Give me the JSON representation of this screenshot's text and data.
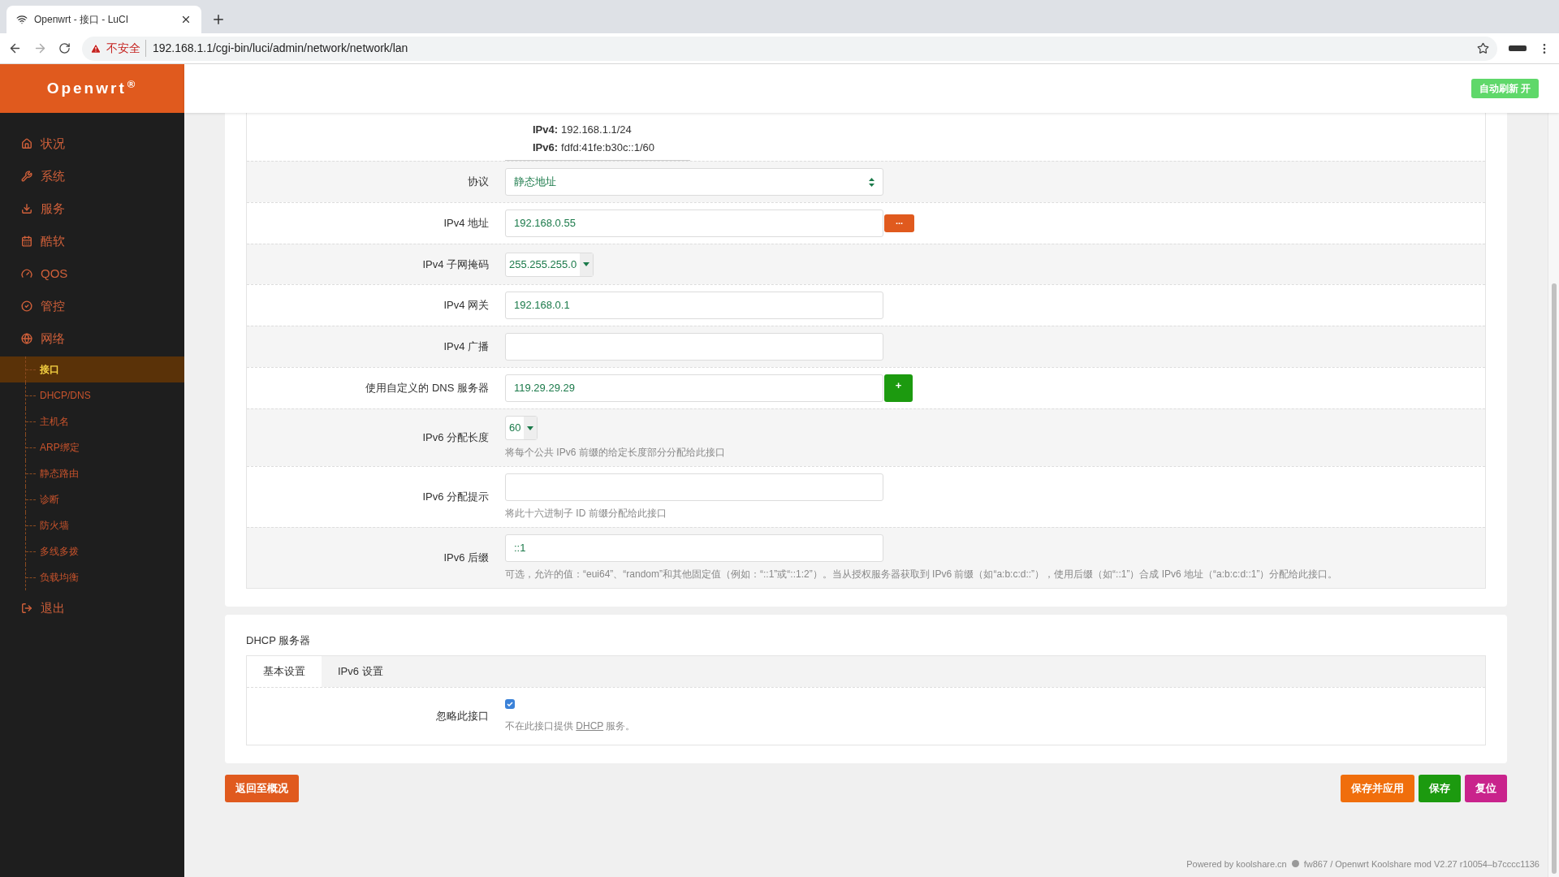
{
  "browser": {
    "tab_title": "Openwrt - 接口 - LuCI",
    "security": "不安全",
    "url": "192.168.1.1/cgi-bin/luci/admin/network/network/lan"
  },
  "sidebar": {
    "logo": "Openwrt",
    "logo_mark": "®",
    "items": [
      {
        "label": "状况",
        "selected": false
      },
      {
        "label": "系统",
        "selected": false
      },
      {
        "label": "服务",
        "selected": false
      },
      {
        "label": "酷软",
        "selected": false
      },
      {
        "label": "QOS",
        "selected": false
      },
      {
        "label": "管控",
        "selected": false
      },
      {
        "label": "网络",
        "selected": false,
        "children": [
          {
            "label": "接口",
            "selected": true
          },
          {
            "label": "DHCP/DNS",
            "selected": false
          },
          {
            "label": "主机名",
            "selected": false
          },
          {
            "label": "ARP绑定",
            "selected": false
          },
          {
            "label": "静态路由",
            "selected": false
          },
          {
            "label": "诊断",
            "selected": false
          },
          {
            "label": "防火墙",
            "selected": false
          },
          {
            "label": "多线多拨",
            "selected": false
          },
          {
            "label": "负载均衡",
            "selected": false
          }
        ]
      },
      {
        "label": "退出",
        "selected": false
      }
    ]
  },
  "header": {
    "auto_refresh": "自动刷新 开"
  },
  "status_box": [
    {
      "label": "IPv4:",
      "value": "192.168.1.1/24"
    },
    {
      "label": "IPv6:",
      "value": "fdfd:41fe:b30c::1/60"
    }
  ],
  "form_rows": [
    {
      "kind": "select",
      "label": "协议",
      "value": "静态地址"
    },
    {
      "kind": "text",
      "label": "IPv4 地址",
      "value": "192.168.0.55",
      "button": {
        "label": "...",
        "kind": "more"
      }
    },
    {
      "kind": "dropdown",
      "label": "IPv4 子网掩码",
      "value": "255.255.255.0"
    },
    {
      "kind": "text",
      "label": "IPv4 网关",
      "value": "192.168.0.1"
    },
    {
      "kind": "text",
      "label": "IPv4 广播"
    },
    {
      "kind": "text",
      "label": "使用自定义的 DNS 服务器",
      "value": "119.29.29.29",
      "button": {
        "label": "+",
        "kind": "add"
      }
    },
    {
      "kind": "dropdown",
      "label": "IPv6 分配长度",
      "value": "60",
      "help": "将每个公共 IPv6 前缀的给定长度部分分配给此接口"
    },
    {
      "kind": "text",
      "label": "IPv6 分配提示",
      "help": "将此十六进制子 ID 前缀分配给此接口"
    },
    {
      "kind": "text",
      "label": "IPv6 后缀",
      "value": "::1",
      "help": "可选，允许的值：“eui64”、“random”和其他固定值（例如：“::1”或“::1:2”）。当从授权服务器获取到 IPv6 前缀（如“a:b:c:d::”），使用后缀（如“::1”）合成 IPv6 地址（“a:b:c:d::1”）分配给此接口。"
    }
  ],
  "dhcp": {
    "title": "DHCP 服务器",
    "tabs": [
      {
        "label": "基本设置",
        "selected": true
      },
      {
        "label": "IPv6 设置",
        "selected": false
      }
    ],
    "ignore": {
      "label": "忽略此接口",
      "checked": true,
      "help_before": "不在此接口提供",
      "help_link": "DHCP",
      "help_after": "服务。"
    }
  },
  "back_button": "返回至概况",
  "actions": [
    {
      "label": "保存并应用",
      "color": "#f06e0c"
    },
    {
      "label": "保存",
      "color": "#1c9a0f"
    },
    {
      "label": "复位",
      "color": "#c9238c"
    }
  ],
  "footer": {
    "left": "Powered by koolshare.cn",
    "right": "fw867 / Openwrt Koolshare mod V2.27 r10054–b7cccc1136"
  }
}
